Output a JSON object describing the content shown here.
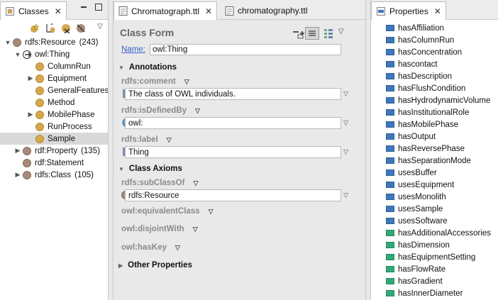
{
  "left": {
    "tab_label": "Classes",
    "tree": [
      {
        "label": "rdfs:Resource",
        "count": "(243)",
        "level": 0,
        "twisty": "▼",
        "dot": "brown"
      },
      {
        "label": "owl:Thing",
        "count": "",
        "level": 1,
        "twisty": "▼",
        "dot": "gold"
      },
      {
        "label": "ColumnRun",
        "count": "",
        "level": 2,
        "twisty": "",
        "dot": "gold"
      },
      {
        "label": "Equipment",
        "count": "",
        "level": 2,
        "twisty": "▶",
        "dot": "gold"
      },
      {
        "label": "GeneralFeatures",
        "count": "",
        "level": 2,
        "twisty": "",
        "dot": "gold"
      },
      {
        "label": "Method",
        "count": "",
        "level": 2,
        "twisty": "",
        "dot": "gold"
      },
      {
        "label": "MobilePhase",
        "count": "",
        "level": 2,
        "twisty": "▶",
        "dot": "gold"
      },
      {
        "label": "RunProcess",
        "count": "",
        "level": 2,
        "twisty": "",
        "dot": "gold"
      },
      {
        "label": "Sample",
        "count": "",
        "level": 2,
        "twisty": "",
        "dot": "gold",
        "selected": true
      },
      {
        "label": "rdf:Property",
        "count": "(135)",
        "level": 1,
        "twisty": "▶",
        "dot": "brown"
      },
      {
        "label": "rdf:Statement",
        "count": "",
        "level": 1,
        "twisty": "",
        "dot": "brown"
      },
      {
        "label": "rdfs:Class",
        "count": "(105)",
        "level": 1,
        "twisty": "▶",
        "dot": "brown"
      }
    ]
  },
  "center": {
    "tabs": [
      {
        "label": "Chromatograph.ttl",
        "active": true
      },
      {
        "label": "chromatography.ttl",
        "active": false
      }
    ],
    "form_title": "Class Form",
    "name_label": "Name:",
    "name_value": "owl:Thing",
    "annotations_title": "Annotations",
    "comment_label": "rdfs:comment",
    "comment_value": "The class of OWL individuals.",
    "isdefinedby_label": "rdfs:isDefinedBy",
    "isdefinedby_value": "owl:",
    "label_label": "rdfs:label",
    "label_value": "Thing",
    "axioms_title": "Class Axioms",
    "subclassof_label": "rdfs:subClassOf",
    "subclassof_value": "rdfs:Resource",
    "equivalent_label": "owl:equivalentClass",
    "disjoint_label": "owl:disjointWith",
    "haskey_label": "owl:hasKey",
    "other_title": "Other Properties"
  },
  "right": {
    "tab_label": "Properties",
    "properties": [
      {
        "label": "hasAffiliation",
        "kind": "obj"
      },
      {
        "label": "hasColumnRun",
        "kind": "obj"
      },
      {
        "label": "hasConcentration",
        "kind": "obj"
      },
      {
        "label": "hascontact",
        "kind": "obj"
      },
      {
        "label": "hasDescription",
        "kind": "obj"
      },
      {
        "label": "hasFlushCondition",
        "kind": "obj"
      },
      {
        "label": "hasHydrodynamicVolume",
        "kind": "obj"
      },
      {
        "label": "hasInstitutionalRole",
        "kind": "obj"
      },
      {
        "label": "hasMobilePhase",
        "kind": "obj"
      },
      {
        "label": "hasOutput",
        "kind": "obj"
      },
      {
        "label": "hasReversePhase",
        "kind": "obj"
      },
      {
        "label": "hasSeparationMode",
        "kind": "obj"
      },
      {
        "label": "usesBuffer",
        "kind": "obj"
      },
      {
        "label": "usesEquipment",
        "kind": "obj"
      },
      {
        "label": "usesMonolith",
        "kind": "obj"
      },
      {
        "label": "usesSample",
        "kind": "obj"
      },
      {
        "label": "usesSoftware",
        "kind": "obj"
      },
      {
        "label": "hasAdditionalAccessories",
        "kind": "data"
      },
      {
        "label": "hasDimension",
        "kind": "data"
      },
      {
        "label": "hasEquipmentSetting",
        "kind": "data"
      },
      {
        "label": "hasFlowRate",
        "kind": "data"
      },
      {
        "label": "hasGradient",
        "kind": "data"
      },
      {
        "label": "hasInnerDiameter",
        "kind": "data"
      }
    ]
  },
  "colors": {
    "link": "#3b5fc8",
    "obj_prop": "#3f78b8",
    "data_prop": "#35a878",
    "owl_thing": "#d4a84f",
    "rdfs_resource": "#a88a7a"
  }
}
